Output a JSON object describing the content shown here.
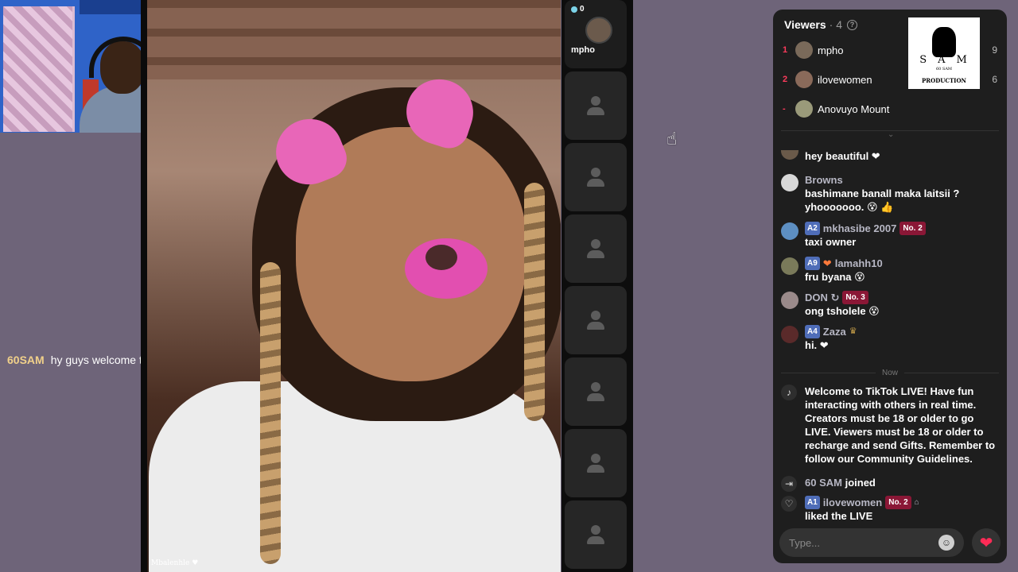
{
  "overlay_chat": {
    "name": "60SAM",
    "text": "hy guys welcome to stream"
  },
  "video": {
    "watermark": "Mbalenhle ♥"
  },
  "host_slot": {
    "count": "0",
    "name": "mpho"
  },
  "viewers": {
    "title": "Viewers",
    "count": "· 4",
    "list": [
      {
        "rank": "1",
        "name": "mpho",
        "score": "9"
      },
      {
        "rank": "2",
        "name": "ilovewomen",
        "score": "6"
      },
      {
        "rank": "-",
        "name": "Anovuyo Mount",
        "score": ""
      }
    ]
  },
  "logo": {
    "letters": "SAM",
    "sub": "60 SAM",
    "production": "PRODUCTION"
  },
  "chat": [
    {
      "user": "",
      "text": "hey beautiful ❤"
    },
    {
      "user": "Browns",
      "text": "bashimane banall maka laitsii ? yhooooooo. 😵 👍"
    },
    {
      "user": "mkhasibe 2007",
      "level": "A2",
      "rank": "No. 2",
      "text": "taxi owner"
    },
    {
      "user": "lamahh10",
      "level": "A9",
      "text": "fru byana 😵"
    },
    {
      "user": "DON ↻",
      "rank": "No. 3",
      "text": "ong tsholele 😵"
    },
    {
      "user": "Zaza",
      "level": "A4",
      "text": "hi. ❤"
    }
  ],
  "now_label": "Now",
  "welcome_text": "Welcome to TikTok LIVE! Have fun interacting with others in real time. Creators must be 18 or older to go LIVE. Viewers must be 18 or older to recharge and send Gifts. Remember to follow our Community Guidelines.",
  "events": [
    {
      "user": "60 SAM",
      "text": "joined"
    },
    {
      "user": "ilovewomen",
      "level": "A1",
      "rank": "No. 2",
      "text": "liked the LIVE"
    }
  ],
  "input": {
    "placeholder": "Type..."
  },
  "colors": {
    "panel_bg": "#1e1e1e",
    "accent": "#ff2b56",
    "page_bg": "#6e6479"
  }
}
